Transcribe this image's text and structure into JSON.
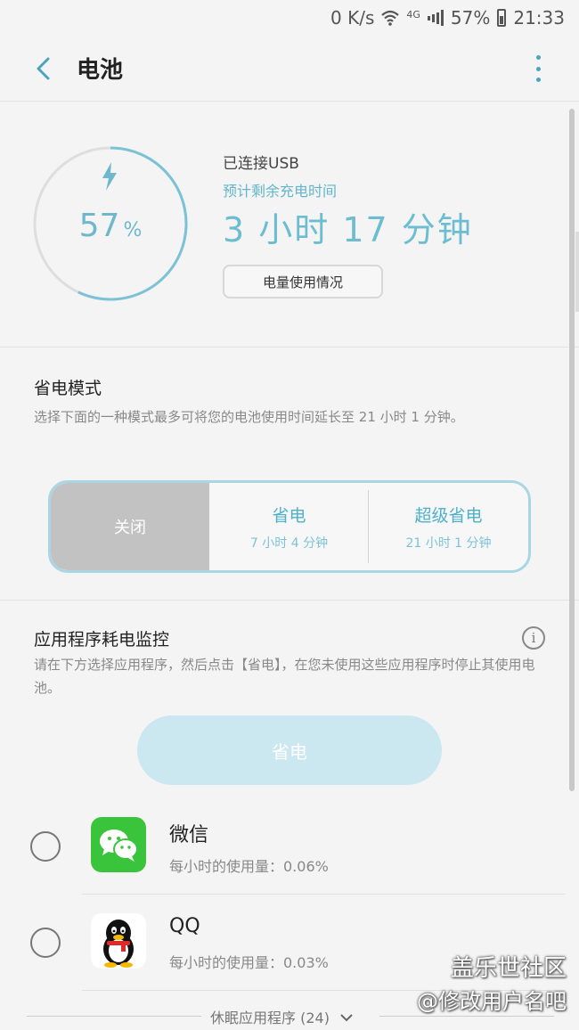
{
  "status_bar": {
    "net_speed": "0 K/s",
    "network_type": "4G",
    "battery_pct": "57%",
    "time": "21:33",
    "icons": [
      "wifi-icon",
      "signal-icon",
      "battery-icon"
    ]
  },
  "app_bar": {
    "title": "电池",
    "back_icon": "chevron-left-icon",
    "more_icon": "more-vert-icon"
  },
  "battery": {
    "level": 0.57,
    "percent_num": "57",
    "percent_sign": "%",
    "connection": "已连接USB",
    "remaining_label": "预计剩余充电时间",
    "remaining_time": "3 小时 17 分钟",
    "usage_button": "电量使用情况",
    "accent_color": "#6cbdd2"
  },
  "power_saving": {
    "title": "省电模式",
    "description": "选择下面的一种模式最多可将您的电池使用时间延长至 21 小时 1 分钟。",
    "modes": [
      {
        "name": "关闭",
        "selected": true
      },
      {
        "name": "省电",
        "time": "7 小时 4 分钟"
      },
      {
        "name": "超级省电",
        "time": "21 小时 1 分钟"
      }
    ]
  },
  "monitor": {
    "title": "应用程序耗电监控",
    "description": "请在下方选择应用程序，然后点击【省电】，在您未使用这些应用程序时停止其使用电池。",
    "save_button": "省电",
    "apps": [
      {
        "name": "微信",
        "usage": "每小时的使用量：0.06%",
        "icon": "wechat-icon"
      },
      {
        "name": "QQ",
        "usage": "每小时的使用量：0.03%",
        "icon": "qq-icon"
      }
    ],
    "sleeping_label": "休眠应用程序 (24)"
  },
  "watermark": {
    "line1": "盖乐世社区",
    "line2": "@修改用户名吧"
  }
}
